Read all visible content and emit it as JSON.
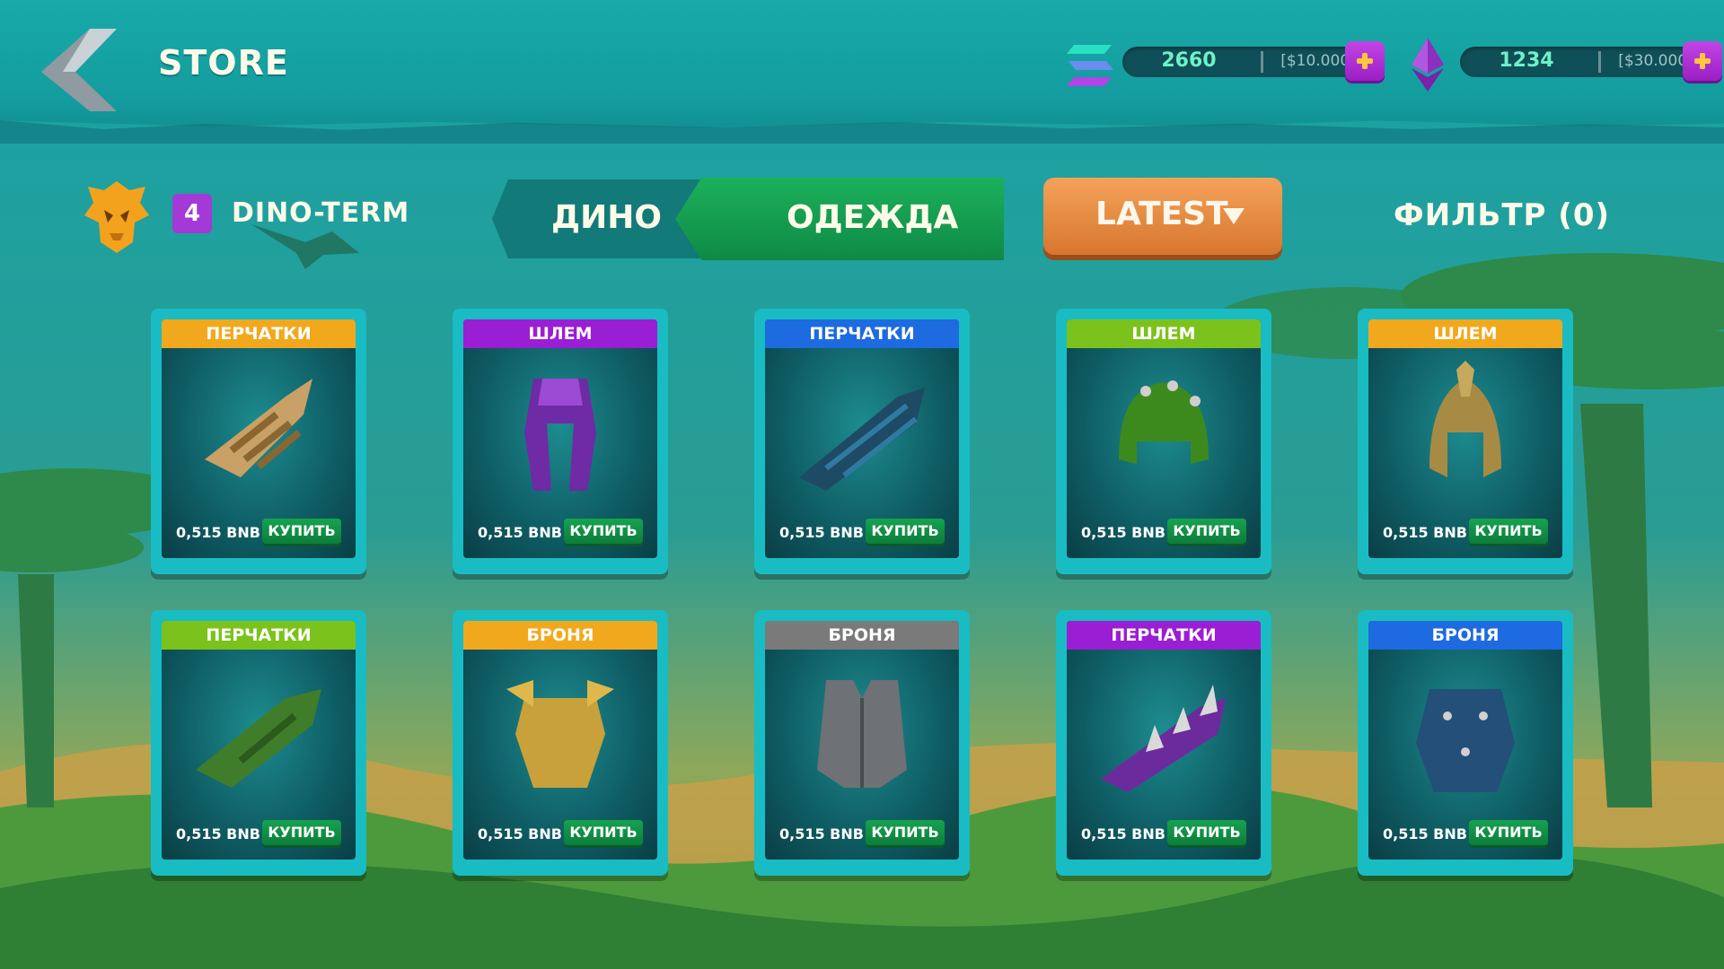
{
  "header": {
    "title": "STORE",
    "currencies": [
      {
        "icon": "solana-icon",
        "amount": "2660",
        "usd": "[$10.000]"
      },
      {
        "icon": "ethereum-icon",
        "amount": "1234",
        "usd": "[$30.000]"
      }
    ]
  },
  "player": {
    "level": "4",
    "name": "DINO-TERM",
    "badge_icon": "dino-skull-badge-icon"
  },
  "tabs": [
    {
      "label": "ДИНО",
      "active": false
    },
    {
      "label": "ОДЕЖДА",
      "active": true
    }
  ],
  "sort": {
    "label": "LATEST"
  },
  "filter": {
    "label": "ФИЛЬТР (0)"
  },
  "items": [
    {
      "category": "ПЕРЧАТКИ",
      "color": "#f2a81d",
      "art": "gold-gauntlet-icon",
      "price": "0,515 BNB",
      "buy": "КУПИТЬ"
    },
    {
      "category": "ШЛЕМ",
      "color": "#9a1ed4",
      "art": "purple-helmet-icon",
      "price": "0,515 BNB",
      "buy": "КУПИТЬ"
    },
    {
      "category": "ПЕРЧАТКИ",
      "color": "#1e6ae0",
      "art": "blue-gauntlet-icon",
      "price": "0,515 BNB",
      "buy": "КУПИТЬ"
    },
    {
      "category": "ШЛЕМ",
      "color": "#7cc21c",
      "art": "green-helmet-icon",
      "price": "0,515 BNB",
      "buy": "КУПИТЬ"
    },
    {
      "category": "ШЛЕМ",
      "color": "#f2a81d",
      "art": "gold-helmet-icon",
      "price": "0,515 BNB",
      "buy": "КУПИТЬ"
    },
    {
      "category": "ПЕРЧАТКИ",
      "color": "#7cc21c",
      "art": "green-gauntlet-icon",
      "price": "0,515 BNB",
      "buy": "КУПИТЬ"
    },
    {
      "category": "БРОНЯ",
      "color": "#f2a81d",
      "art": "gold-armor-icon",
      "price": "0,515 BNB",
      "buy": "КУПИТЬ"
    },
    {
      "category": "БРОНЯ",
      "color": "#7a7a7a",
      "art": "gray-vest-icon",
      "price": "0,515 BNB",
      "buy": "КУПИТЬ"
    },
    {
      "category": "ПЕРЧАТКИ",
      "color": "#9a1ed4",
      "art": "purple-spiked-gauntlet-icon",
      "price": "0,515 BNB",
      "buy": "КУПИТЬ"
    },
    {
      "category": "БРОНЯ",
      "color": "#1e6ae0",
      "art": "blue-armor-icon",
      "price": "0,515 BNB",
      "buy": "КУПИТЬ"
    }
  ]
}
